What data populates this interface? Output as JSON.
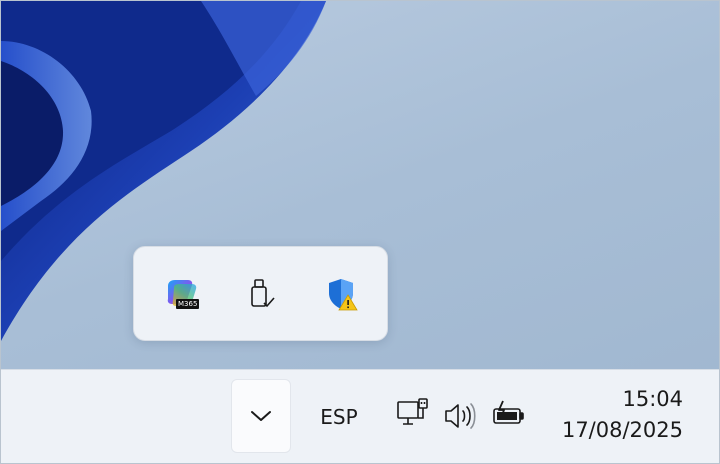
{
  "overflow_flyout": {
    "icons": [
      "m365-copilot-icon",
      "usb-safe-remove-icon",
      "security-shield-warning-icon"
    ],
    "m365_badge": "M365"
  },
  "taskbar": {
    "chevron_icon": "chevron-down-icon",
    "language": "ESP",
    "network_icon": "wired-network-icon",
    "volume_icon": "speaker-volume-icon",
    "battery_icon": "battery-charging-icon",
    "clock": {
      "time": "15:04",
      "date": "17/08/2025"
    }
  },
  "colors": {
    "taskbar_bg": "#eef2f7",
    "wallpaper_blue": "#1e44b8",
    "warning_yellow": "#f5c518",
    "shield_blue": "#1d6fd6"
  }
}
